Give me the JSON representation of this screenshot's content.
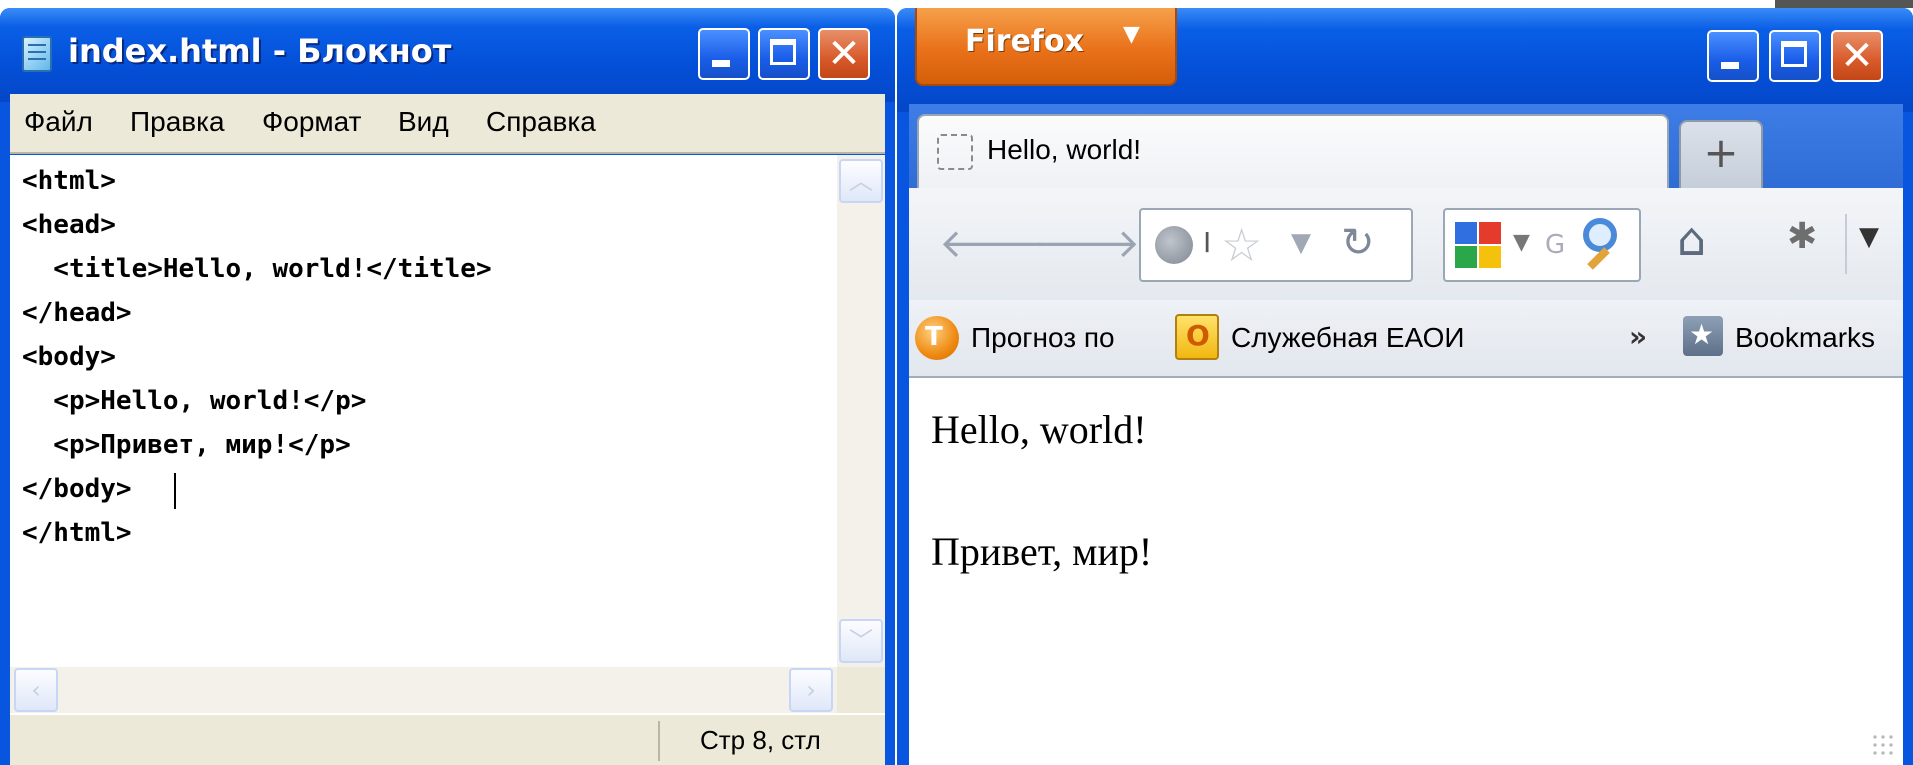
{
  "notepad": {
    "title": "index.html - Блокнот",
    "menu": [
      "Файл",
      "Правка",
      "Формат",
      "Вид",
      "Справка"
    ],
    "code_lines": [
      "<html>",
      "<head>",
      "  <title>Hello, world!</title>",
      "</head>",
      "<body>",
      "  <p>Hello, world!</p>",
      "  <p>Привет, мир!</p>",
      "</body>",
      "</html>"
    ],
    "status": "Стр 8, стл"
  },
  "firefox": {
    "button_label": "Firefox",
    "tab_title": "Hello, world!",
    "new_tab_label": "+",
    "url_text": "I",
    "search_hint": "G",
    "bookmarks": [
      {
        "label": "Прогноз по",
        "icon": "weather-icon"
      },
      {
        "label": "Служебная ЕАОИ",
        "icon": "outlook-icon"
      }
    ],
    "bookmarks_overflow": "»",
    "bookmarks_menu": "Bookmarks",
    "page": {
      "p1": "Hello, world!",
      "p2": "Привет, мир!"
    }
  },
  "colors": {
    "xp_title_blue": "#0450d8",
    "firefox_orange": "#e9711a",
    "menubar_beige": "#ece9d8"
  }
}
